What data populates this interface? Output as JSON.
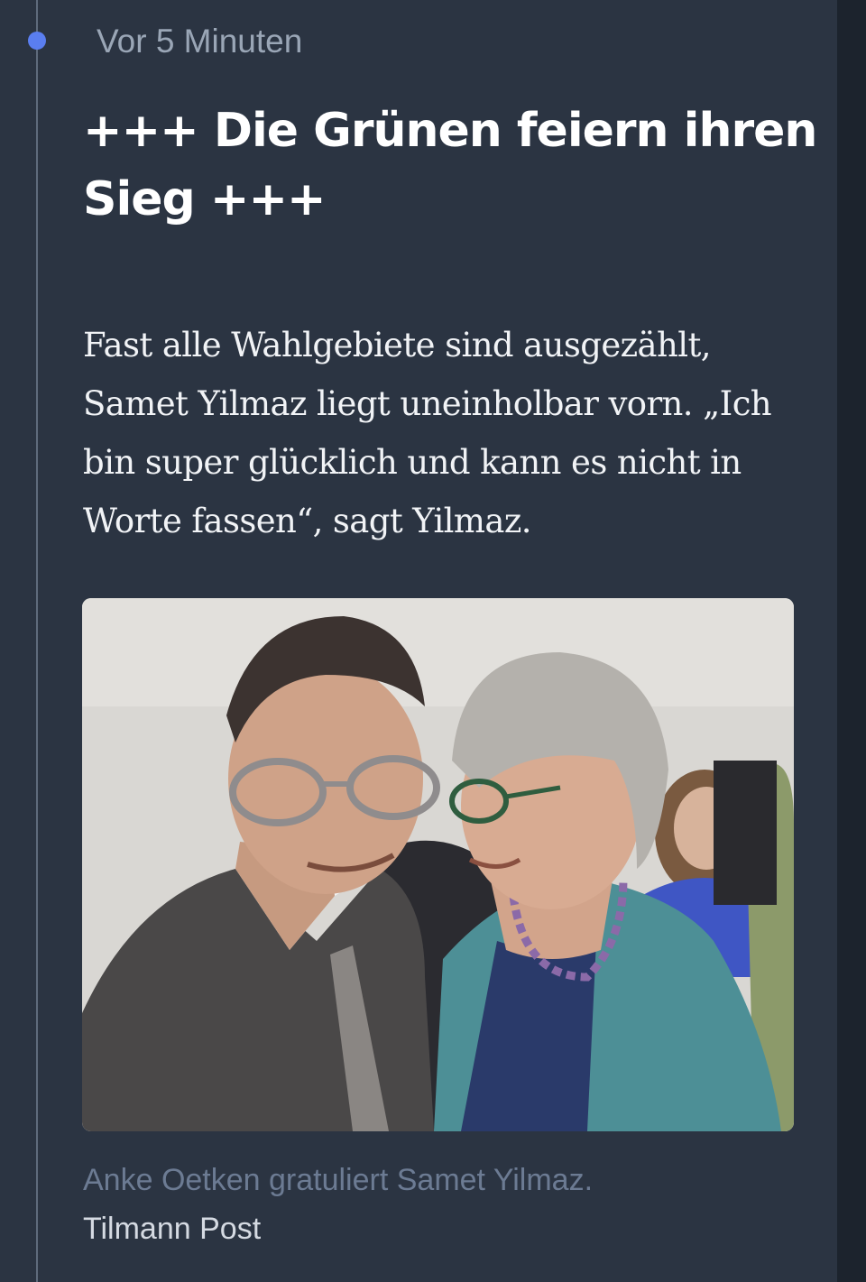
{
  "entry": {
    "timestamp": "Vor 5 Minuten",
    "headline": "+++ Die Grünen feiern ihren Sieg +++",
    "body": "Fast alle Wahlgebiete sind ausgezählt, Samet Yilmaz liegt uneinholbar vorn. „Ich bin super glücklich und kann es nicht in Worte fassen“, sagt Yilmaz.",
    "image": {
      "caption": "Anke Oetken gratuliert Samet Yilmaz.",
      "credit": "Tilmann Post"
    }
  },
  "colors": {
    "background": "#2b3442",
    "timeline_dot": "#5a7ef0",
    "headline": "#ffffff",
    "caption": "#6c7b93"
  }
}
